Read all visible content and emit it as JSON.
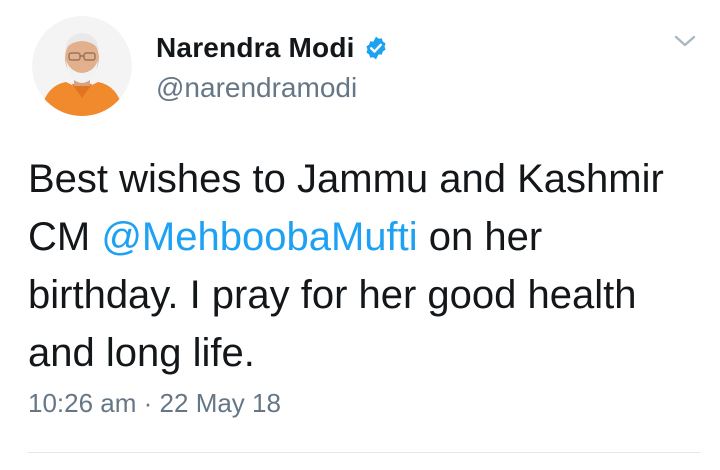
{
  "author": {
    "display_name": "Narendra Modi",
    "handle": "@narendramodi",
    "verified": true,
    "avatar_icon": "profile-photo"
  },
  "tweet": {
    "text_before_mention": "Best wishes to Jammu and Kashmir CM ",
    "mention": "@MehboobaMufti",
    "text_after_mention": " on her birthday. I pray for her good health and long life.",
    "time": "10:26 am",
    "separator": "·",
    "date": "22 May 18"
  },
  "icons": {
    "verified": "verified-badge-icon",
    "menu": "chevron-down-icon"
  },
  "colors": {
    "link": "#1da1f2",
    "verified_badge": "#1da1f2",
    "secondary_text": "#657786",
    "primary_text": "#14171a"
  }
}
